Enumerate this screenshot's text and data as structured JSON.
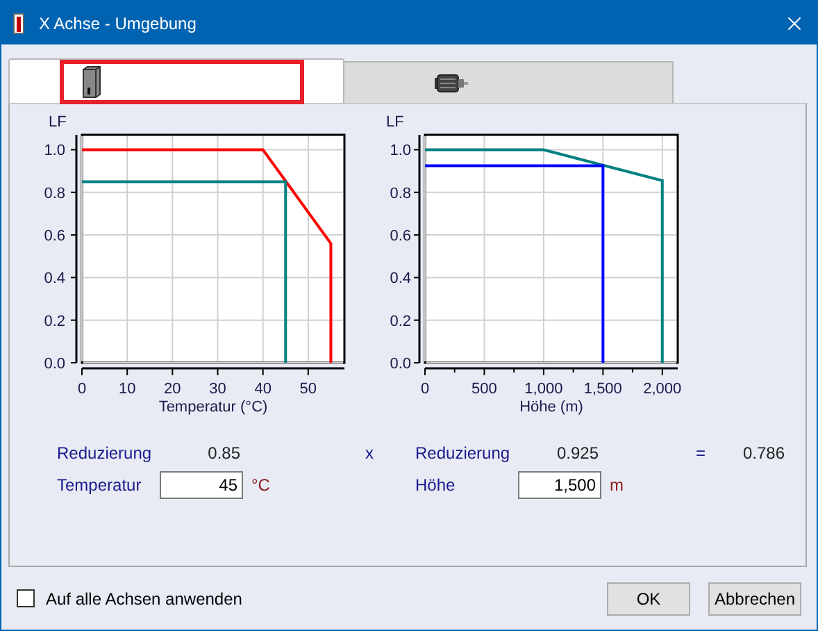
{
  "window": {
    "title": "X Achse - Umgebung"
  },
  "tabs": [
    {
      "kind": "cabinet",
      "selected": true
    },
    {
      "kind": "motor",
      "selected": false
    }
  ],
  "charts": [
    {
      "chart_data": {
        "type": "line",
        "xlabel": "Temperatur (°C)",
        "ylabel": "LF",
        "xlim": [
          0,
          58
        ],
        "ylim": [
          0,
          1.07
        ],
        "xticks": [
          0,
          10,
          20,
          30,
          40,
          50
        ],
        "yticks": [
          {
            "value": 0,
            "label": "0.0"
          },
          {
            "value": 0.2,
            "label": "0.2"
          },
          {
            "value": 0.4,
            "label": "0.4"
          },
          {
            "value": 0.6,
            "label": "0.6"
          },
          {
            "value": 0.8,
            "label": "0.8"
          },
          {
            "value": 1,
            "label": "1.0"
          }
        ],
        "grid": true,
        "series": [
          {
            "color": "#ff0000",
            "x": [
              0,
              40,
              55,
              55
            ],
            "values": [
              1,
              1,
              0.56,
              0
            ]
          },
          {
            "color": "#008080",
            "x": [
              0,
              45,
              45
            ],
            "values": [
              0.85,
              0.85,
              0
            ]
          }
        ]
      }
    },
    {
      "chart_data": {
        "type": "line",
        "xlabel": "Höhe (m)",
        "ylabel": "LF",
        "xlim": [
          0,
          2130
        ],
        "ylim": [
          0,
          1.07
        ],
        "xticks": [
          0,
          500,
          {
            "value": 1000,
            "label": "1,000"
          },
          {
            "value": 1500,
            "label": "1,500"
          },
          {
            "value": 2000,
            "label": "2,000"
          }
        ],
        "yticks": [
          {
            "value": 0,
            "label": "0.0"
          },
          {
            "value": 0.2,
            "label": "0.2"
          },
          {
            "value": 0.4,
            "label": "0.4"
          },
          {
            "value": 0.6,
            "label": "0.6"
          },
          {
            "value": 0.8,
            "label": "0.8"
          },
          {
            "value": 1,
            "label": "1.0"
          }
        ],
        "grid": true,
        "series": [
          {
            "color": "#008080",
            "x": [
              0,
              1000,
              2000,
              2000
            ],
            "values": [
              1,
              1,
              0.855,
              0
            ]
          },
          {
            "color": "#0000ff",
            "x": [
              0,
              1500,
              1500
            ],
            "values": [
              0.925,
              0.925,
              0
            ]
          }
        ]
      }
    }
  ],
  "reduction": {
    "label_1": "Reduzierung",
    "value_1": "0.85",
    "operator_1": "x",
    "label_2": "Reduzierung",
    "value_2": "0.925",
    "operator_2": "=",
    "result": "0.786"
  },
  "inputs": [
    {
      "label": "Temperatur",
      "value": "45",
      "unit": "°C"
    },
    {
      "label": "Höhe",
      "value": "1,500",
      "unit": "m"
    }
  ],
  "apply_all": {
    "label": "Auf alle Achsen anwenden",
    "checked": false
  },
  "buttons": [
    "OK",
    "Abbrechen"
  ]
}
